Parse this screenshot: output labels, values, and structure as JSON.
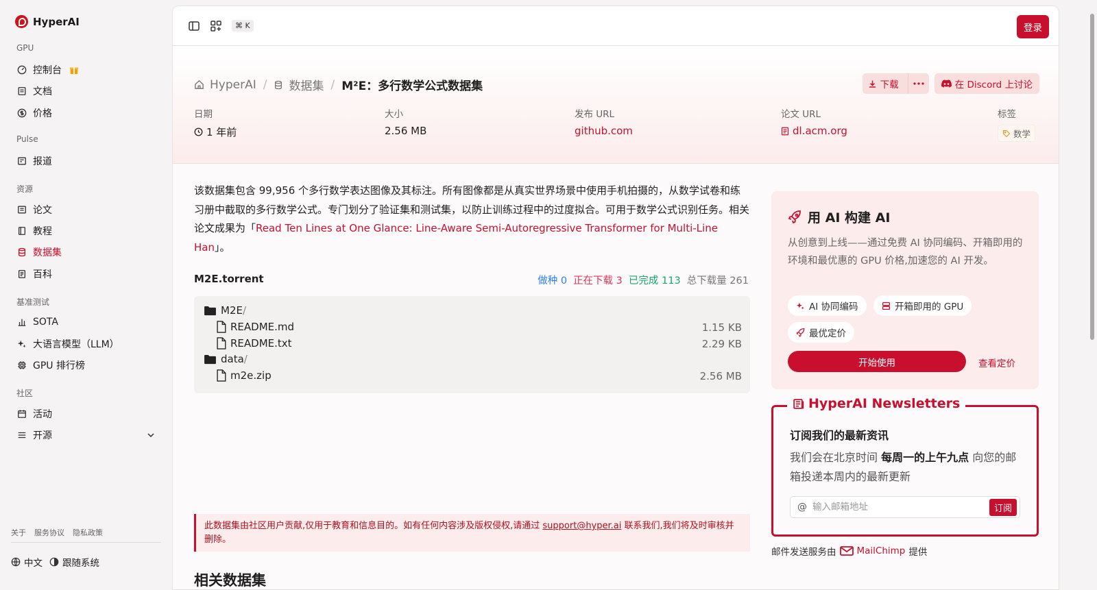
{
  "brand": "HyperAI",
  "sidebar": {
    "sections": {
      "gpu": "GPU",
      "pulse": "Pulse",
      "resources": "资源",
      "benchmarks": "基准测试",
      "community": "社区"
    },
    "items": {
      "console": "控制台",
      "docs": "文档",
      "pricing": "价格",
      "news": "报道",
      "papers": "论文",
      "tutorials": "教程",
      "datasets": "数据集",
      "wiki": "百科",
      "sota": "SOTA",
      "llm": "大语言模型（LLM）",
      "gpu_rank": "GPU 排行榜",
      "events": "活动",
      "open_source": "开源"
    },
    "footer": {
      "about": "关于",
      "terms": "服务协议",
      "privacy": "隐私政策"
    },
    "language": "中文",
    "theme": "跟随系统"
  },
  "topbar": {
    "shortcut": "⌘ K",
    "login": "登录"
  },
  "breadcrumb": {
    "home": "HyperAI",
    "section": "数据集",
    "current": "M²E：多行数学公式数据集"
  },
  "actions": {
    "download": "下载",
    "discord": "在 Discord 上讨论"
  },
  "meta": {
    "date_label": "日期",
    "date_value": "1 年前",
    "size_label": "大小",
    "size_value": "2.56 MB",
    "release_label": "发布 URL",
    "release_value": "github.com",
    "paper_label": "论文 URL",
    "paper_value": "dl.acm.org",
    "tags_label": "标签",
    "tag": "数学"
  },
  "description": {
    "text": "该数据集包含 99,956 个多行数学表达图像及其标注。所有图像都是从真实世界场景中使用手机拍摄的，从数学试卷和练习册中截取的多行数学公式。专门划分了验证集和测试集，以防止训练过程中的过度拟合。可用于数学公式识别任务。相关论文成果为「",
    "link": "Read Ten Lines at One Glance: Line-Aware Semi-Autoregressive Transformer for Multi-Line Han",
    "suffix": "」。"
  },
  "torrent": {
    "name": "M2E.torrent",
    "seeding": "做种 0",
    "downloading": "正在下载 3",
    "completed": "已完成 113",
    "total": "总下载量 261",
    "files": [
      {
        "name": "M2E",
        "slash": "/",
        "size": ""
      },
      {
        "name": "README.md",
        "slash": "",
        "size": "1.15 KB"
      },
      {
        "name": "README.txt",
        "slash": "",
        "size": "2.29 KB"
      },
      {
        "name": "data",
        "slash": "/",
        "size": ""
      },
      {
        "name": "m2e.zip",
        "slash": "",
        "size": "2.56 MB"
      }
    ]
  },
  "notice": {
    "prefix": "此数据集由社区用户贡献,仅用于教育和信息目的。如有任何内容涉及版权侵权,请通过 ",
    "email": "support@hyper.ai",
    "suffix": " 联系我们,我们将及时审核并删除。"
  },
  "related_title": "相关数据集",
  "promo": {
    "title": "用 AI 构建 AI",
    "text": "从创意到上线——通过免费 AI 协同编码、开箱即用的环境和最优惠的 GPU 价格,加速您的 AI 开发。",
    "chip1": "AI 协同编码",
    "chip2": "开箱即用的 GPU",
    "chip3": "最优定价",
    "start": "开始使用",
    "view_pricing": "查看定价"
  },
  "newsletter": {
    "title": "HyperAI Newsletters",
    "heading": "订阅我们的最新资讯",
    "text_a": "我们会在北京时间 ",
    "text_b": "每周一的上午九点",
    "text_c": " 向您的邮箱投递本周内的最新更新",
    "placeholder": "输入邮箱地址",
    "subscribe": "订阅",
    "provider_a": "邮件发送服务由",
    "provider_b": "MailChimp",
    "provider_c": "提供"
  },
  "colors": {
    "accent": "#c8102e",
    "seeding": "#2f80ed",
    "downloading": "#e2335a",
    "completed": "#17a86b"
  }
}
